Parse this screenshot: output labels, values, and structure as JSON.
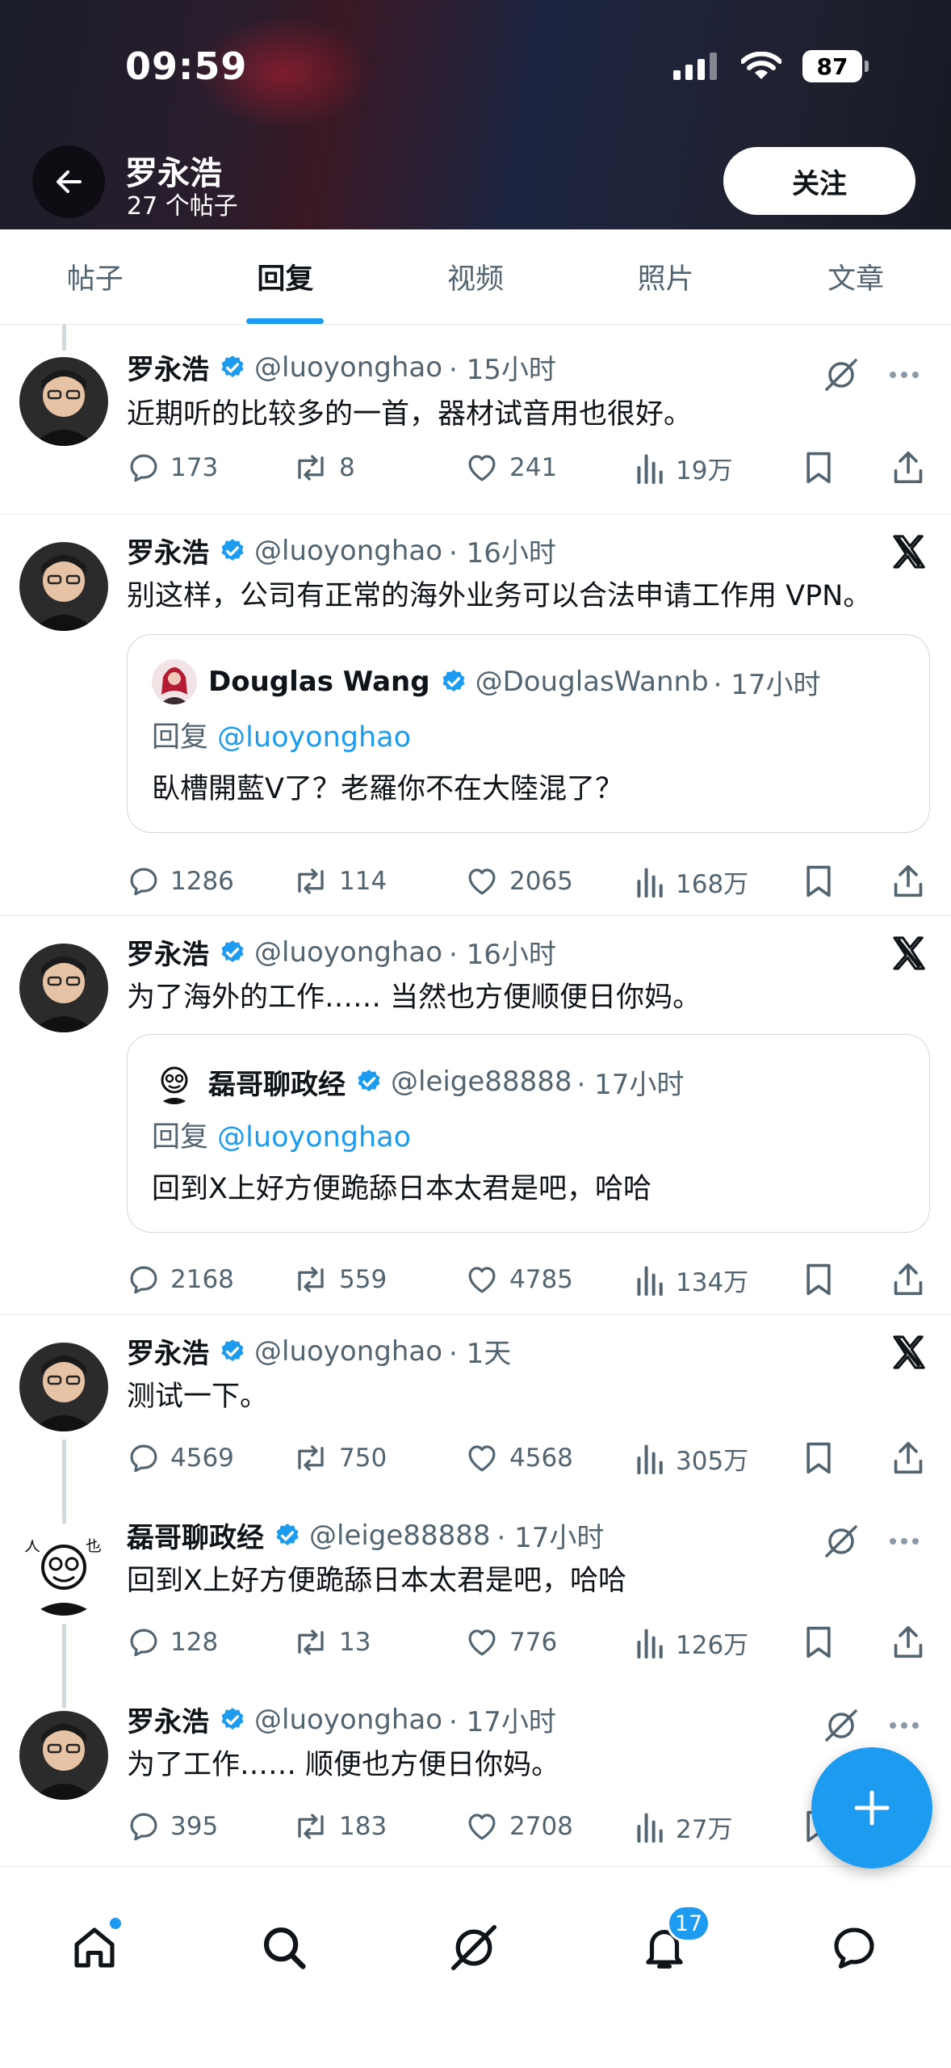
{
  "status_bar": {
    "time": "09:59",
    "battery": "87"
  },
  "profile": {
    "name": "罗永浩",
    "post_count": "27 个帖子",
    "follow_label": "关注"
  },
  "tabs": [
    {
      "label": "帖子"
    },
    {
      "label": "回复",
      "active": true
    },
    {
      "label": "视频"
    },
    {
      "label": "照片"
    },
    {
      "label": "文章"
    }
  ],
  "posts": [
    {
      "name": "罗永浩",
      "handle": "@luoyonghao",
      "time": "· 15小时",
      "text": "近期听的比较多的一首，器材试音用也很好。",
      "top_icons": [
        "grok-icon",
        "more-icon"
      ],
      "stats": {
        "replies": "173",
        "reposts": "8",
        "likes": "241",
        "views": "19万"
      }
    },
    {
      "name": "罗永浩",
      "handle": "@luoyonghao",
      "time": "· 16小时",
      "text": "别这样，公司有正常的海外业务可以合法申请工作用 VPN。",
      "top_icons": [
        "x-logo-icon"
      ],
      "quote": {
        "name": "Douglas Wang",
        "handle": "@DouglasWannb",
        "time": "· 17小时",
        "reply_prefix": "回复",
        "reply_to": "@luoyonghao",
        "text": "臥槽開藍V了？老羅你不在大陸混了？"
      },
      "stats": {
        "replies": "1286",
        "reposts": "114",
        "likes": "2065",
        "views": "168万"
      }
    },
    {
      "name": "罗永浩",
      "handle": "@luoyonghao",
      "time": "· 16小时",
      "text": "为了海外的工作…… 当然也方便顺便日你妈。",
      "top_icons": [
        "x-logo-icon"
      ],
      "quote": {
        "name": "磊哥聊政经",
        "handle": "@leige88888",
        "time": "· 17小时",
        "reply_prefix": "回复",
        "reply_to": "@luoyonghao",
        "text": "回到X上好方便跪舔日本太君是吧，哈哈"
      },
      "stats": {
        "replies": "2168",
        "reposts": "559",
        "likes": "4785",
        "views": "134万"
      }
    },
    {
      "name": "罗永浩",
      "handle": "@luoyonghao",
      "time": "· 1天",
      "text": "测试一下。",
      "top_icons": [
        "x-logo-icon"
      ],
      "stats": {
        "replies": "4569",
        "reposts": "750",
        "likes": "4568",
        "views": "305万"
      }
    },
    {
      "name": "磊哥聊政经",
      "handle": "@leige88888",
      "time": "· 17小时",
      "text": "回到X上好方便跪舔日本太君是吧，哈哈",
      "top_icons": [
        "grok-icon",
        "more-icon"
      ],
      "stats": {
        "replies": "128",
        "reposts": "13",
        "likes": "776",
        "views": "126万"
      }
    },
    {
      "name": "罗永浩",
      "handle": "@luoyonghao",
      "time": "· 17小时",
      "text": "为了工作…… 顺便也方便日你妈。",
      "top_icons": [
        "grok-icon",
        "more-icon"
      ],
      "stats": {
        "replies": "395",
        "reposts": "183",
        "likes": "2708",
        "views": "27万"
      }
    }
  ],
  "bottom_nav": {
    "notifications_badge": "17"
  },
  "colors": {
    "accent": "#1d9bf0",
    "text": "#0f1419",
    "muted": "#536471",
    "divider": "#e6e9ec"
  }
}
